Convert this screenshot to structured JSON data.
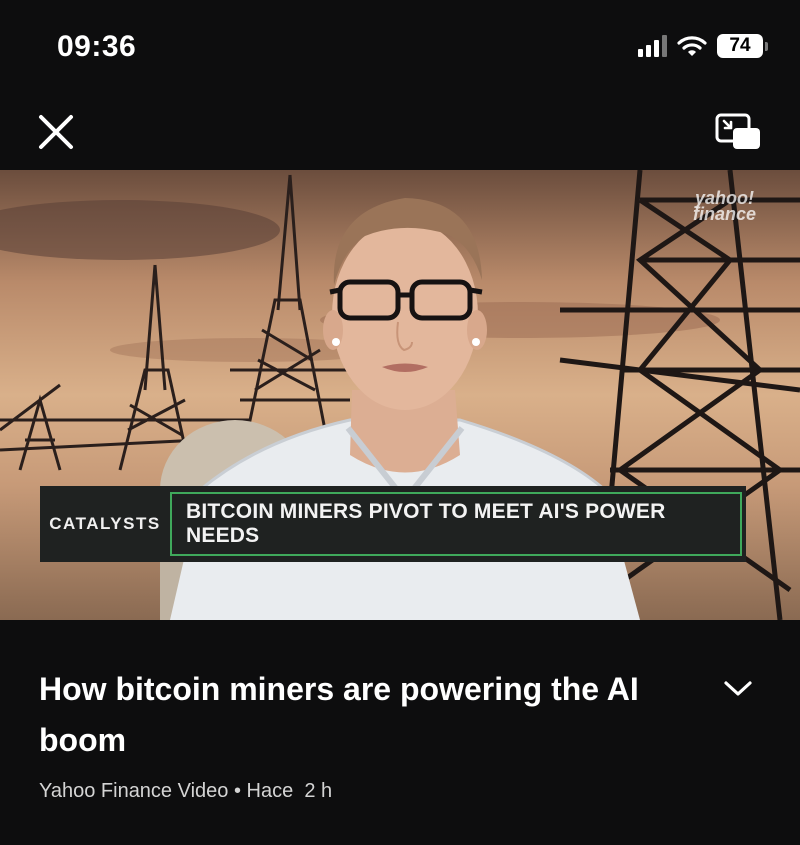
{
  "status_bar": {
    "time": "09:36",
    "battery": "74"
  },
  "video": {
    "watermark_line1": "yahoo!",
    "watermark_line2": "finance",
    "lower_third_tag": "CATALYSTS",
    "lower_third_headline": "BITCOIN MINERS PIVOT TO MEET AI'S POWER NEEDS"
  },
  "article": {
    "title": "How bitcoin miners are powering the AI boom",
    "source": "Yahoo Finance Video",
    "separator": "•",
    "time_ago": "Hace  2 h"
  },
  "icons": {
    "close": "close-icon",
    "pip": "picture-in-picture-icon",
    "chevron": "chevron-down-icon",
    "signal": "cellular-signal-icon",
    "wifi": "wifi-icon",
    "battery": "battery-icon"
  },
  "colors": {
    "background": "#0d0d0e",
    "lower_third_border": "#3fa95b"
  }
}
